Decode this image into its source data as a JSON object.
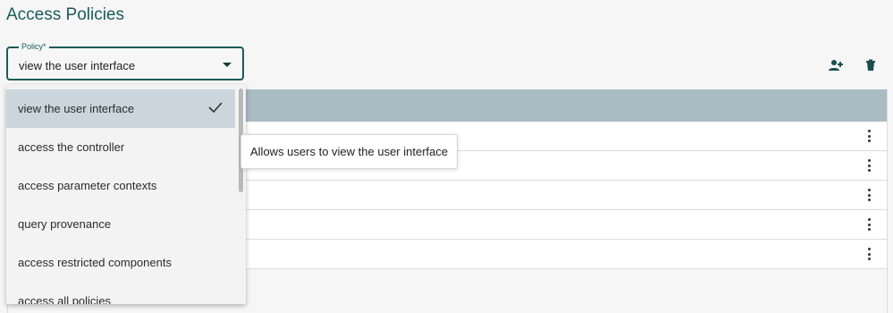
{
  "page": {
    "title": "Access Policies"
  },
  "policy": {
    "label": "Policy*",
    "value": "view the user interface",
    "options": [
      {
        "label": "view the user interface",
        "selected": true
      },
      {
        "label": "access the controller",
        "selected": false
      },
      {
        "label": "access parameter contexts",
        "selected": false
      },
      {
        "label": "query provenance",
        "selected": false
      },
      {
        "label": "access restricted components",
        "selected": false
      },
      {
        "label": "access all policies",
        "selected": false
      }
    ]
  },
  "tooltip": {
    "text": "Allows users to view the user interface"
  },
  "toolbar": {
    "add_icon": "add-user-icon",
    "delete_icon": "delete-icon"
  },
  "table": {
    "header_color": "#a9bcc3",
    "row_count": 5,
    "row_menu_icon": "more-vert-icon"
  },
  "colors": {
    "accent": "#1b5b5b",
    "selected_option": "#cbd6dc"
  }
}
